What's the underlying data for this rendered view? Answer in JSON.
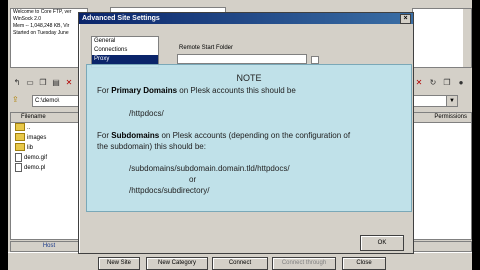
{
  "dialog": {
    "title": "Advanced Site Settings",
    "close_symbol": "×",
    "tree": [
      "General",
      "Connections",
      "Proxy"
    ],
    "remote_label": "Remote Start Folder",
    "ok_label": "OK"
  },
  "note": {
    "heading": "NOTE",
    "p1_pre": "For ",
    "p1_bold": "Primary Domains",
    "p1_post": " on Plesk accounts this should be",
    "p1_path": "/httpdocs/",
    "p2_pre": "For ",
    "p2_bold": "Subdomains",
    "p2_post": " on Plesk accounts (depending on the configuration of",
    "p2_line2": "the subdomain) this should be:",
    "path_a": "/subdomains/subdomain.domain.tld/httpdocs/",
    "or": "or",
    "path_b": "/httpdocs/subdirectory/"
  },
  "log": [
    "Welcome to Core FTP, ver",
    "WinSock 2.0",
    "Mem -- 1,048,248 KB, Vir",
    "Started on Tuesday June"
  ],
  "local": {
    "path": "C:\\demo\\",
    "column": "Filename",
    "files": [
      {
        "name": "..",
        "type": "folder"
      },
      {
        "name": "images",
        "type": "folder"
      },
      {
        "name": "lib",
        "type": "folder"
      },
      {
        "name": "demo.gif",
        "type": "file"
      },
      {
        "name": "demo.pl",
        "type": "file"
      }
    ],
    "host_label": "Host"
  },
  "remote": {
    "column": "Permissions"
  },
  "buttons": {
    "new_site": "New Site",
    "new_category": "New Category",
    "connect": "Connect",
    "connect_through": "Connect through",
    "close": "Close"
  },
  "colors": {
    "titlebar": "#0a246a",
    "note_bg": "#bee2ec",
    "folder": "#e8c84a"
  }
}
